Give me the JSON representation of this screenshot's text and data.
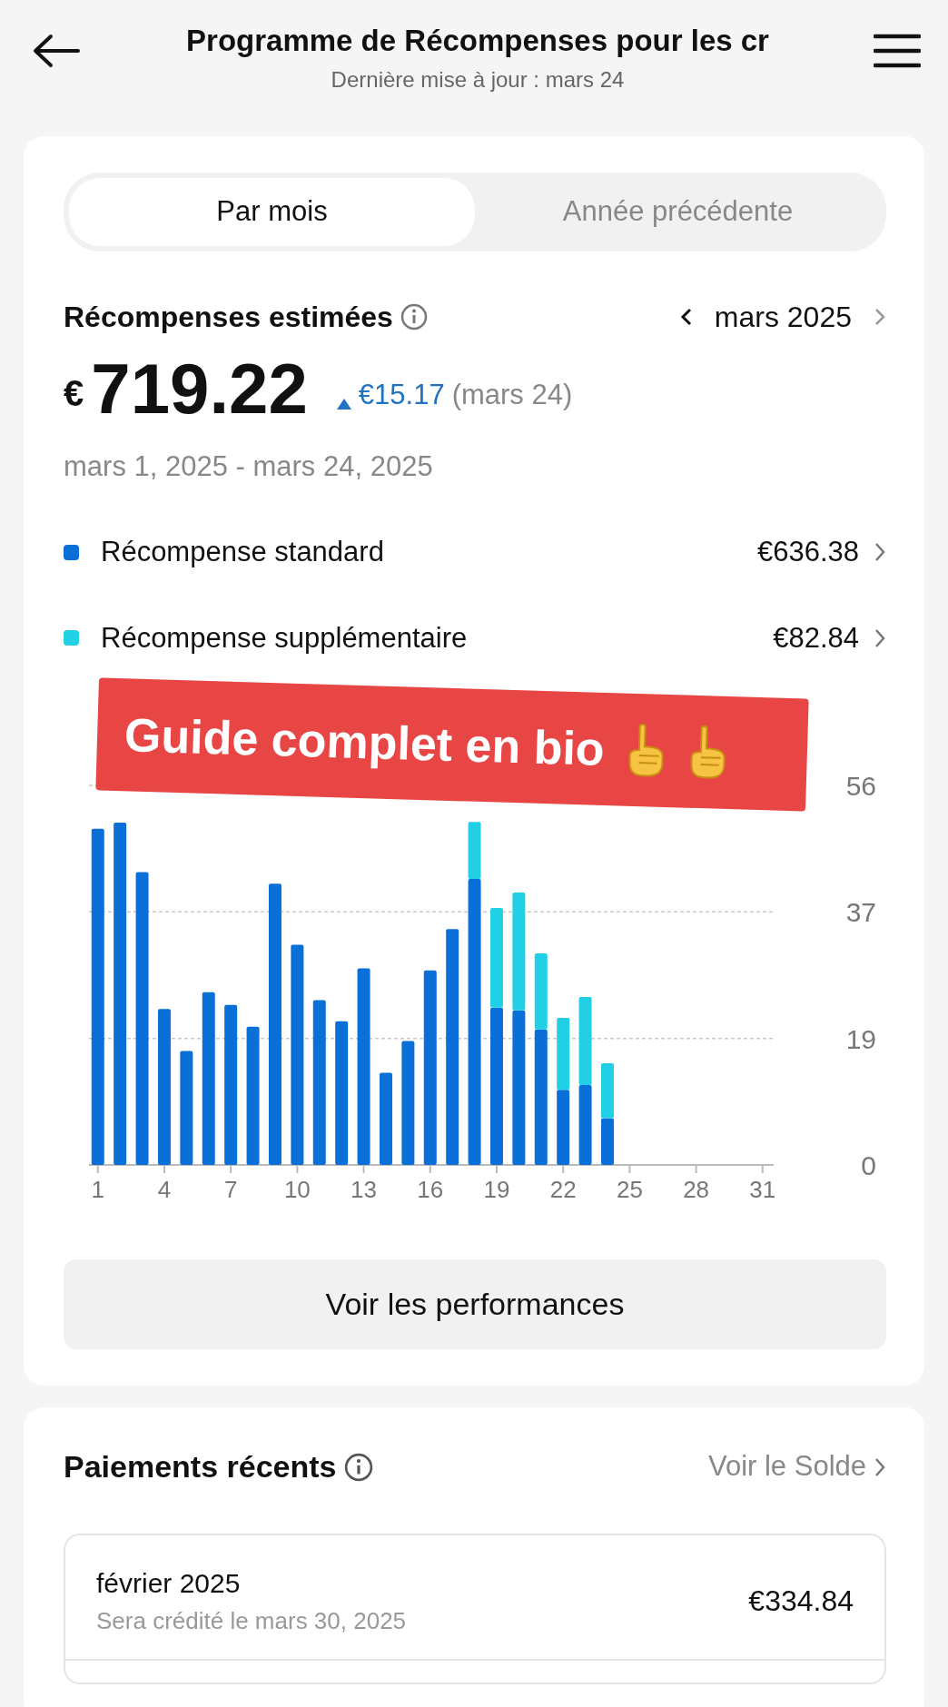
{
  "header": {
    "title": "Programme de Récompenses pour les cr",
    "subtitle": "Dernière mise à jour : mars 24"
  },
  "tabs": [
    {
      "label": "Par mois",
      "selected": true
    },
    {
      "label": "Année précédente",
      "selected": false
    }
  ],
  "summary": {
    "title": "Récompenses estimées",
    "month": "mars 2025",
    "currency": "€",
    "amount": "719.22",
    "change": "€15.17",
    "change_date": "(mars 24)",
    "period": "mars 1, 2025 - mars 24, 2025"
  },
  "legend": [
    {
      "value": "€636.38"
    },
    {
      "value": "€82.84"
    }
  ],
  "chart_data": {
    "type": "bar",
    "stacked": true,
    "x": [
      1,
      2,
      3,
      4,
      5,
      6,
      7,
      8,
      9,
      10,
      11,
      12,
      13,
      14,
      15,
      16,
      17,
      18,
      19,
      20,
      21,
      22,
      23,
      24
    ],
    "series": [
      {
        "name": "Récompense standard",
        "color": "#0a6fd6",
        "values": [
          49.6,
          50.5,
          43.2,
          23.0,
          16.8,
          25.5,
          23.6,
          20.4,
          41.5,
          32.5,
          24.3,
          21.2,
          29.0,
          13.6,
          18.3,
          28.7,
          34.8,
          42.2,
          23.2,
          22.8,
          20.0,
          11.1,
          11.8,
          6.9
        ]
      },
      {
        "name": "Récompense supplémentaire",
        "color": "#22d0e6",
        "values": [
          0,
          0,
          0,
          0,
          0,
          0,
          0,
          0,
          0,
          0,
          0,
          0,
          0,
          0,
          0,
          0,
          0,
          8.4,
          14.7,
          17.4,
          11.2,
          10.6,
          13.0,
          8.1
        ]
      }
    ],
    "xlim": [
      0.6,
      31.5
    ],
    "xticks": [
      1,
      4,
      7,
      10,
      13,
      16,
      19,
      22,
      25,
      28,
      31
    ],
    "yticks": [
      {
        "value": 0,
        "label": "0"
      },
      {
        "value": 18.67,
        "label": "19"
      },
      {
        "value": 37.33,
        "label": "37"
      },
      {
        "value": 56,
        "label": "56"
      }
    ],
    "ylim": [
      0,
      56
    ]
  },
  "overlay_banner": {
    "text": "Guide complet en bio"
  },
  "performance_button": "Voir les performances",
  "payments": {
    "title": "Paiements récents",
    "link": "Voir le Solde",
    "items": [
      {
        "month": "février 2025",
        "note": "Sera crédité le mars 30, 2025",
        "amount": "€334.84"
      }
    ]
  }
}
